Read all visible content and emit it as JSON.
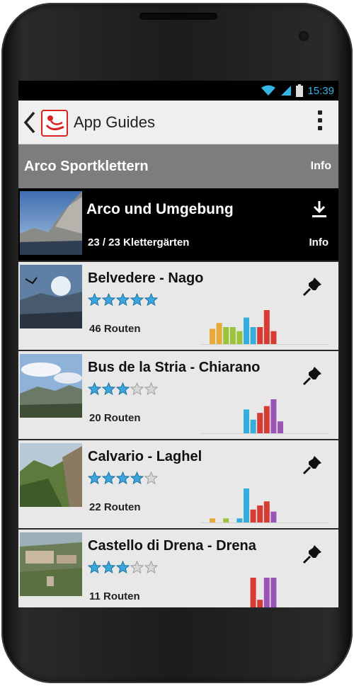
{
  "statusbar": {
    "time": "15:39"
  },
  "actionbar": {
    "title": "App Guides"
  },
  "section": {
    "title": "Arco Sportklettern",
    "info_label": "Info"
  },
  "region": {
    "title": "Arco und Umgebung",
    "count": "23 / 23 Klettergärten",
    "info_label": "Info"
  },
  "colors": {
    "accent": "#35b5e5",
    "header_gray": "#7d7d7d",
    "star": "#3aa6dd",
    "grades": [
      "#e6a93a",
      "#9cc43b",
      "#35aede",
      "#d63b34",
      "#9b55b6"
    ]
  },
  "crags": [
    {
      "name": "Belvedere - Nago",
      "stars": 5,
      "routes": "46 Routen",
      "histogram": [
        {
          "g": 0,
          "v": 0.45
        },
        {
          "g": 0,
          "v": 0.62
        },
        {
          "g": 1,
          "v": 0.5
        },
        {
          "g": 1,
          "v": 0.5
        },
        {
          "g": 1,
          "v": 0.38
        },
        {
          "g": 2,
          "v": 0.78
        },
        {
          "g": 2,
          "v": 0.5
        },
        {
          "g": 3,
          "v": 0.5
        },
        {
          "g": 3,
          "v": 1.0
        },
        {
          "g": 3,
          "v": 0.38
        }
      ]
    },
    {
      "name": "Bus de la Stria - Chiarano",
      "stars": 3,
      "routes": "20 Routen",
      "histogram": [
        {
          "g": null,
          "v": 0
        },
        {
          "g": null,
          "v": 0
        },
        {
          "g": null,
          "v": 0
        },
        {
          "g": null,
          "v": 0
        },
        {
          "g": null,
          "v": 0
        },
        {
          "g": 2,
          "v": 0.7
        },
        {
          "g": 2,
          "v": 0.4
        },
        {
          "g": 3,
          "v": 0.6
        },
        {
          "g": 3,
          "v": 0.8
        },
        {
          "g": 4,
          "v": 1.0
        },
        {
          "g": 4,
          "v": 0.35
        }
      ]
    },
    {
      "name": "Calvario - Laghel",
      "stars": 4,
      "routes": "22 Routen",
      "histogram": [
        {
          "g": 0,
          "v": 0.12
        },
        {
          "g": null,
          "v": 0
        },
        {
          "g": 1,
          "v": 0.12
        },
        {
          "g": null,
          "v": 0
        },
        {
          "g": 2,
          "v": 0.12
        },
        {
          "g": 2,
          "v": 1.0
        },
        {
          "g": 3,
          "v": 0.38
        },
        {
          "g": 3,
          "v": 0.5
        },
        {
          "g": 3,
          "v": 0.62
        },
        {
          "g": 4,
          "v": 0.32
        }
      ]
    },
    {
      "name": "Castello di Drena - Drena",
      "stars": 3,
      "routes": "11 Routen",
      "histogram": [
        {
          "g": null,
          "v": 0
        },
        {
          "g": null,
          "v": 0
        },
        {
          "g": null,
          "v": 0
        },
        {
          "g": null,
          "v": 0
        },
        {
          "g": null,
          "v": 0
        },
        {
          "g": null,
          "v": 0
        },
        {
          "g": 3,
          "v": 1.0
        },
        {
          "g": 3,
          "v": 0.35
        },
        {
          "g": 4,
          "v": 1.0
        },
        {
          "g": 4,
          "v": 1.0
        }
      ]
    }
  ]
}
